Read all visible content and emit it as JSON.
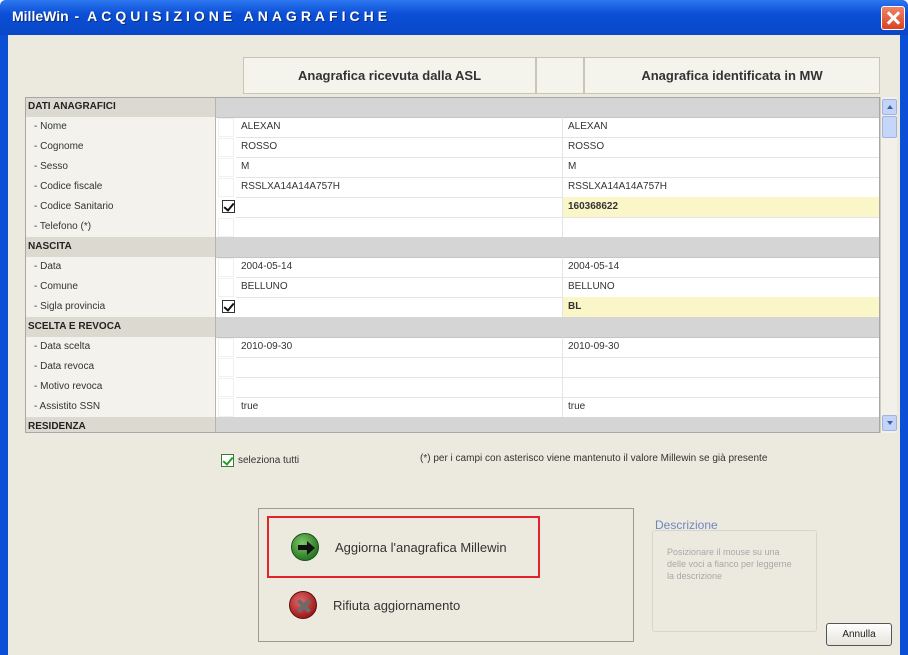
{
  "window": {
    "app_name": "MilleWin",
    "title_sep": " - ",
    "title_text": "ACQUISIZIONE ANAGRAFICHE"
  },
  "headers": {
    "asl": "Anagrafica ricevuta dalla ASL",
    "mw": "Anagrafica identificata in MW"
  },
  "rows": [
    {
      "label": "DATI ANAGRAFICI",
      "section": true
    },
    {
      "label": " - Nome",
      "asl": "ALEXAN",
      "mw": "ALEXAN",
      "checked": false,
      "highlight": false
    },
    {
      "label": " - Cognome",
      "asl": "ROSSO",
      "mw": "ROSSO",
      "checked": false,
      "highlight": false
    },
    {
      "label": " - Sesso",
      "asl": "M",
      "mw": "M",
      "checked": false,
      "highlight": false
    },
    {
      "label": " - Codice fiscale",
      "asl": "RSSLXA14A14A757H",
      "mw": "RSSLXA14A14A757H",
      "checked": false,
      "highlight": false
    },
    {
      "label": " - Codice Sanitario",
      "asl": "",
      "mw": "160368622",
      "checked": true,
      "highlight": true
    },
    {
      "label": " - Telefono (*)",
      "asl": "",
      "mw": "",
      "checked": false,
      "highlight": false
    },
    {
      "label": "NASCITA",
      "section": true
    },
    {
      "label": " - Data",
      "asl": "2004-05-14",
      "mw": "2004-05-14",
      "checked": false,
      "highlight": false
    },
    {
      "label": " - Comune",
      "asl": "BELLUNO",
      "mw": "BELLUNO",
      "checked": false,
      "highlight": false
    },
    {
      "label": " - Sigla provincia",
      "asl": "",
      "mw": "BL",
      "checked": true,
      "highlight": true
    },
    {
      "label": "SCELTA E REVOCA",
      "section": true
    },
    {
      "label": " - Data scelta",
      "asl": "2010-09-30",
      "mw": "2010-09-30",
      "checked": false,
      "highlight": false
    },
    {
      "label": " - Data revoca",
      "asl": "",
      "mw": "",
      "checked": false,
      "highlight": false
    },
    {
      "label": " - Motivo revoca",
      "asl": "",
      "mw": "",
      "checked": false,
      "highlight": false
    },
    {
      "label": " - Assistito SSN",
      "asl": "true",
      "mw": "true",
      "checked": false,
      "highlight": false
    },
    {
      "label": "RESIDENZA",
      "section": true
    }
  ],
  "select_all": {
    "label": "seleziona tutti",
    "checked": true
  },
  "note": "(*) per i campi con asterisco viene mantenuto il valore Millewin se già presente",
  "actions": {
    "update_label": "Aggiorna l'anagrafica Millewin",
    "refuse_label": "Rifiuta aggiornamento"
  },
  "description": {
    "title": "Descrizione",
    "text": "Posizionare il mouse su una delle voci a fianco per leggerne la descrizione"
  },
  "cancel_label": "Annulla",
  "colors": {
    "title_bar": "#0b4fd6",
    "highlight_row": "#fbf6c8",
    "update_border": "#e3232a"
  }
}
